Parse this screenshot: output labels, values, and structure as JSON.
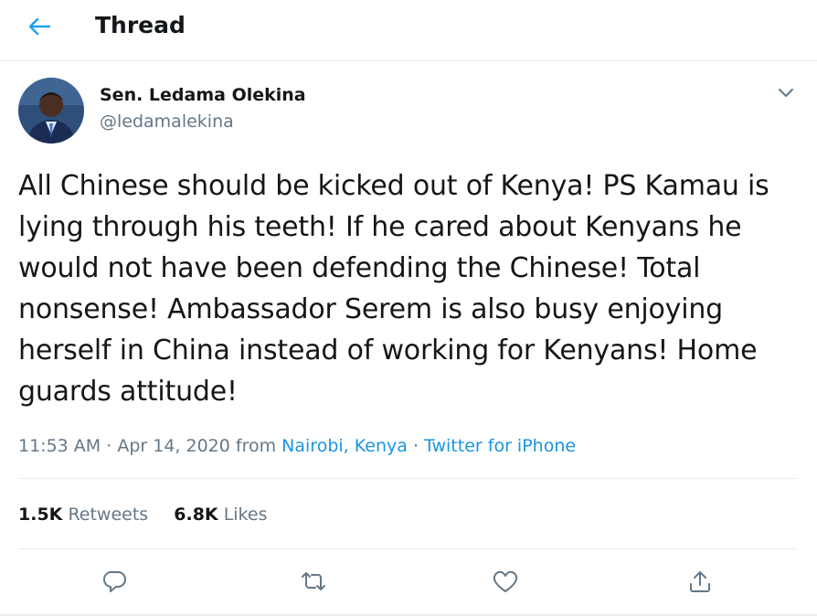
{
  "header": {
    "title": "Thread",
    "back_icon": "arrow-left-icon"
  },
  "tweet": {
    "display_name": "Sen. Ledama Olekina",
    "handle": "@ledamalekina",
    "text": "All Chinese should be kicked out of Kenya! PS Kamau is lying through his teeth! If he cared about Kenyans he would not have been defending the Chinese! Total nonsense! Ambassador Serem is also busy enjoying herself in China instead of working for Kenyans! Home guards attitude!",
    "time": "11:53 AM",
    "date": "Apr 14, 2020",
    "from_label": "from",
    "location": "Nairobi, Kenya",
    "separator": "·",
    "source": "Twitter for iPhone"
  },
  "stats": {
    "retweets_count": "1.5K",
    "retweets_label": "Retweets",
    "likes_count": "6.8K",
    "likes_label": "Likes"
  },
  "actions": {
    "reply_icon": "reply-icon",
    "retweet_icon": "retweet-icon",
    "like_icon": "heart-icon",
    "share_icon": "share-icon"
  },
  "colors": {
    "accent": "#1da1f2",
    "link": "#1b95e0",
    "secondary_text": "#657786",
    "primary_text": "#14171a",
    "border": "#e6ecf0"
  }
}
